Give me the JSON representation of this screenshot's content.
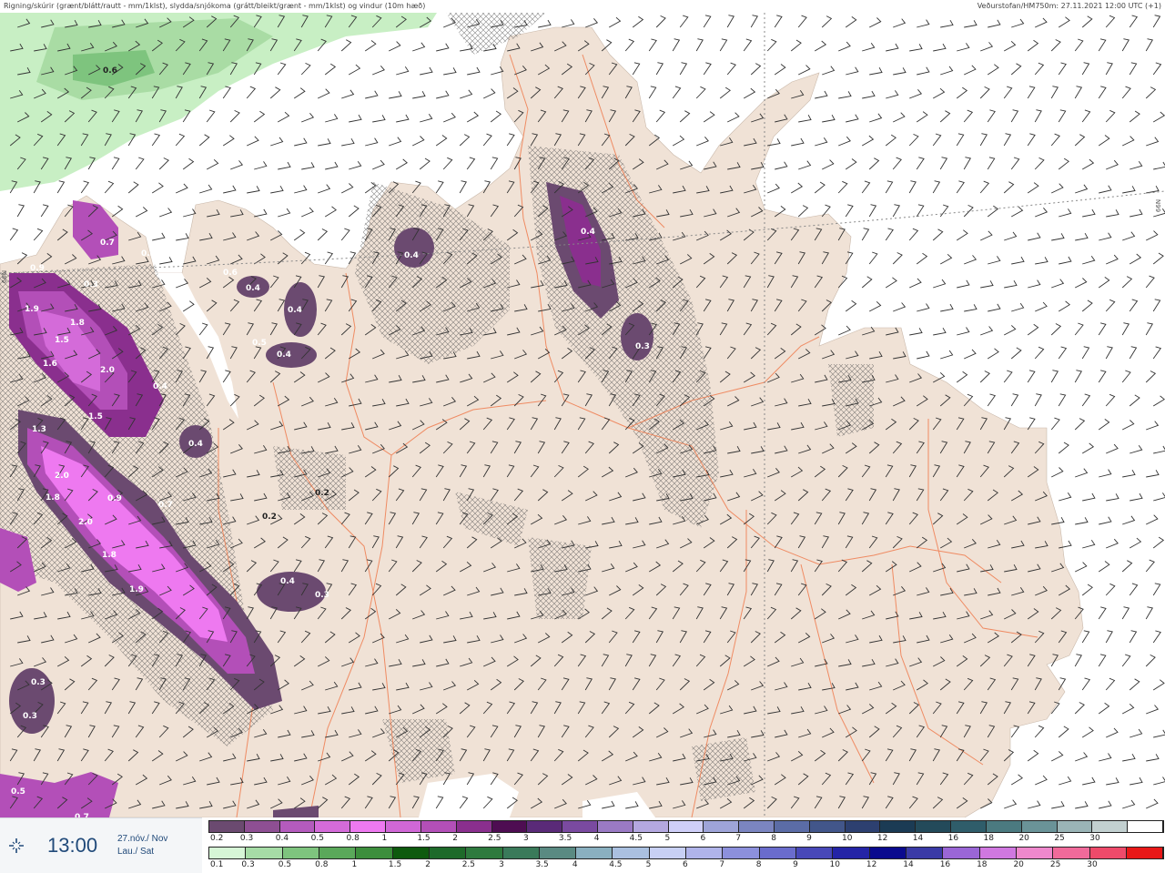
{
  "header": {
    "left": "Rigning/skúrir (grænt/blátt/rautt - mm/1klst), slydda/snjókoma (grátt/bleikt/grænt - mm/1klst) og vindur (10m hæð)",
    "right": "Veðurstofan/HM750m: 27.11.2021 12:00 UTC (+1)"
  },
  "map": {
    "land_color": "#f0e2d6",
    "road_color": "#ef7c4f",
    "latitude_labels": [
      "66N",
      "66N"
    ],
    "precip_labels": [
      "0.6",
      "0.7",
      "0.3",
      "0.9",
      "0.3",
      "1.9",
      "1.8",
      "1.5",
      "1.6",
      "2.0",
      "0.4",
      "1.5",
      "0.4",
      "1.3",
      "2.0",
      "1.8",
      "0.9",
      "0.7",
      "2.0",
      "1.8",
      "1.9",
      "0.3",
      "0.3",
      "0.5",
      "0.7",
      "0.6",
      "0.4",
      "0.4",
      "0.5",
      "0.4",
      "0.4",
      "0.4",
      "0.4",
      "0.3",
      "0.2",
      "0.2",
      "0.4",
      "0.3"
    ]
  },
  "time": {
    "value": "13:00",
    "date": "27.nóv./ Nov",
    "day": "Lau./ Sat",
    "icon": "timeline-icon"
  },
  "legend_top": {
    "labels": [
      "0.2",
      "0.3",
      "0.4",
      "0.5",
      "0.8",
      "1",
      "1.5",
      "2",
      "2.5",
      "3",
      "3.5",
      "4",
      "4.5",
      "5",
      "6",
      "7",
      "8",
      "9",
      "10",
      "12",
      "14",
      "16",
      "18",
      "20",
      "25",
      "30"
    ],
    "colors": [
      "#6b4a70",
      "#8e4f93",
      "#b45bbd",
      "#d46bd9",
      "#ee79f0",
      "#d067d6",
      "#b34fb8",
      "#8a2f8e",
      "#4e0d52",
      "#5a2a78",
      "#7a4aa0",
      "#9a7ac4",
      "#b4a8e0",
      "#cfcff8",
      "#9ea4d8",
      "#7b85c0",
      "#5b6ca6",
      "#42568a",
      "#2d4070",
      "#1b3b54",
      "#234a5a",
      "#2f5d6a",
      "#4b7a80",
      "#6a9398",
      "#9ab4b6",
      "#c2d0d0",
      "#ffffff"
    ]
  },
  "legend_bottom": {
    "labels": [
      "0.1",
      "0.3",
      "0.5",
      "0.8",
      "1",
      "1.5",
      "2",
      "2.5",
      "3",
      "3.5",
      "4",
      "4.5",
      "5",
      "6",
      "7",
      "8",
      "9",
      "10",
      "12",
      "14",
      "16",
      "18",
      "20",
      "25",
      "30"
    ],
    "colors": [
      "#d6f6d6",
      "#a6dca6",
      "#7ec47e",
      "#5aa85a",
      "#3c8e3c",
      "#0e5a0e",
      "#1e6a2a",
      "#2e7a3e",
      "#3a7a5a",
      "#5a8a82",
      "#8ab0c0",
      "#aac0e0",
      "#c8d0f4",
      "#b0b4ea",
      "#8c90dc",
      "#6a6ccc",
      "#4848b8",
      "#2424a6",
      "#0a0a8e",
      "#3a3aa6",
      "#9a66d6",
      "#d078e0",
      "#ee88cc",
      "#f06a9a",
      "#ee4a6a",
      "#e81818"
    ]
  }
}
